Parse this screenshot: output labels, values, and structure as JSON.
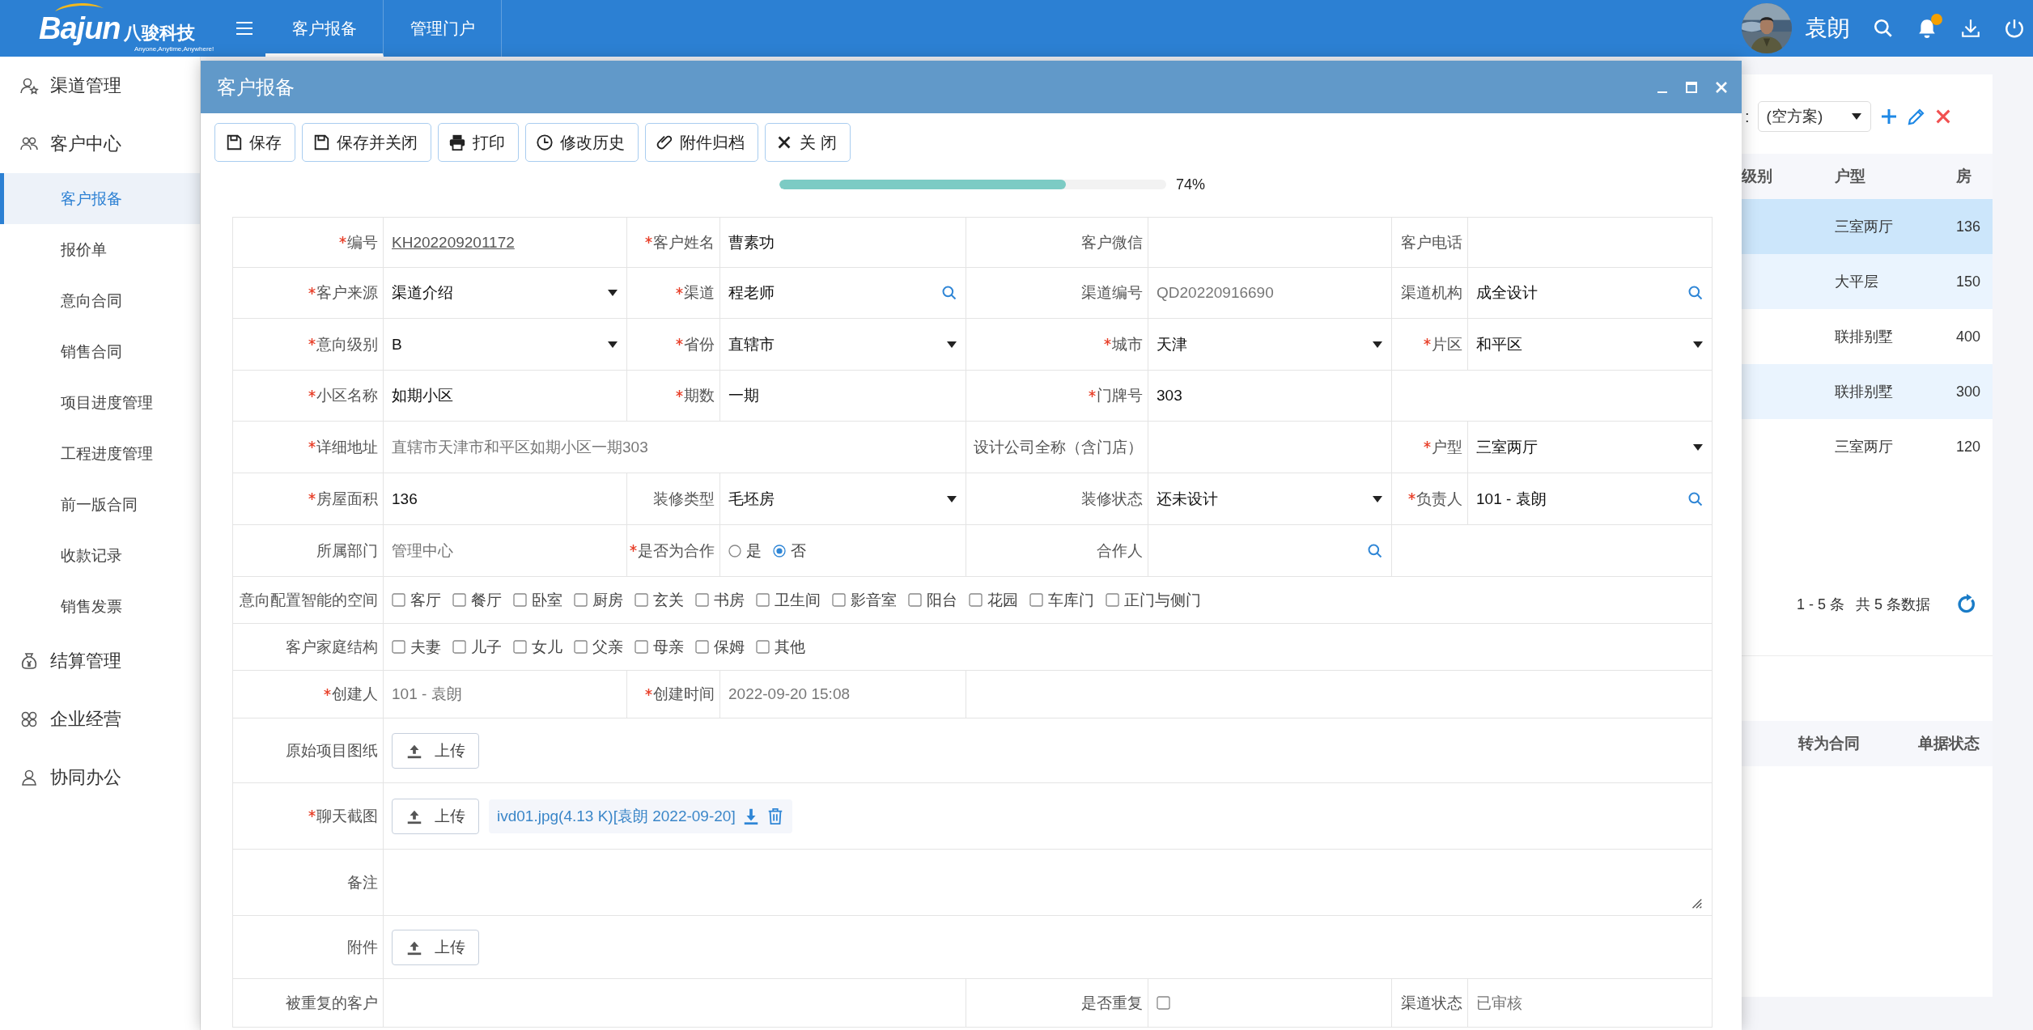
{
  "header": {
    "logo": {
      "brand": "Bajun",
      "name": "八骏科技",
      "tagline": "Anyone,Anytime,Anywhere!"
    },
    "tabs": [
      {
        "label": "客户报备",
        "selected": true
      },
      {
        "label": "管理门户",
        "selected": false
      }
    ],
    "user": {
      "name": "袁朗"
    },
    "notification_dot": true
  },
  "sidebar": {
    "items": [
      {
        "label": "渠道管理"
      },
      {
        "label": "客户中心",
        "children": [
          {
            "label": "客户报备",
            "selected": true
          },
          {
            "label": "报价单",
            "selected": false
          },
          {
            "label": "意向合同",
            "selected": false
          },
          {
            "label": "销售合同",
            "selected": false
          },
          {
            "label": "项目进度管理",
            "selected": false
          },
          {
            "label": "工程进度管理",
            "selected": false
          },
          {
            "label": "前一版合同",
            "selected": false
          },
          {
            "label": "收款记录",
            "selected": false
          },
          {
            "label": "销售发票",
            "selected": false
          }
        ]
      },
      {
        "label": "结算管理"
      },
      {
        "label": "企业经营"
      },
      {
        "label": "协同办公"
      }
    ]
  },
  "background": {
    "scheme": {
      "label": ":",
      "value": "(空方案)"
    },
    "table": {
      "columns": [
        "级别",
        "户型",
        "房"
      ],
      "rows": [
        {
          "cells": [
            "",
            "三室两厅",
            "136"
          ],
          "selected": true
        },
        {
          "cells": [
            "",
            "大平层",
            "150"
          ],
          "selected": false
        },
        {
          "cells": [
            "",
            "联排别墅",
            "400"
          ],
          "selected": false
        },
        {
          "cells": [
            "",
            "联排别墅",
            "300"
          ],
          "selected": false
        },
        {
          "cells": [
            "",
            "三室两厅",
            "120"
          ],
          "selected": false
        }
      ]
    },
    "pagination": {
      "range": "1 - 5 条",
      "total": "共 5 条数据"
    },
    "table_2": {
      "columns": [
        "转为合同",
        "单据状态"
      ]
    }
  },
  "dialog": {
    "title": "客户报备",
    "toolbar": [
      {
        "label": "保存"
      },
      {
        "label": "保存并关闭"
      },
      {
        "label": "打印"
      },
      {
        "label": "修改历史"
      },
      {
        "label": "附件归档"
      },
      {
        "label": "关 闭"
      }
    ],
    "progress": {
      "level": 0.74,
      "reading": "74%"
    }
  },
  "form": {
    "rows": [
      {
        "fields": [
          {
            "label": "编号",
            "required": true,
            "kind": "link",
            "value": "KH202209201172"
          },
          {
            "label": "客户姓名",
            "required": true,
            "kind": "input",
            "value": "曹素功"
          },
          {
            "label": "客户微信",
            "required": false,
            "kind": "input"
          },
          {
            "label": "客户电话",
            "required": false,
            "kind": "input"
          }
        ]
      },
      {
        "fields": [
          {
            "label": "客户来源",
            "required": true,
            "kind": "select",
            "value": "渠道介绍"
          },
          {
            "label": "渠道",
            "required": true,
            "kind": "lookup",
            "value": "程老师"
          },
          {
            "label": "渠道编号",
            "required": false,
            "kind": "text",
            "value": "QD20220916690"
          },
          {
            "label": "渠道机构",
            "required": false,
            "kind": "lookup",
            "value": "成全设计"
          }
        ]
      },
      {
        "fields": [
          {
            "label": "意向级别",
            "required": true,
            "kind": "select",
            "value": "B"
          },
          {
            "label": "省份",
            "required": true,
            "kind": "select",
            "value": "直辖市"
          },
          {
            "label": "城市",
            "required": true,
            "kind": "select",
            "value": "天津"
          },
          {
            "label": "片区",
            "required": true,
            "kind": "select",
            "value": "和平区"
          }
        ]
      },
      {
        "fields": [
          {
            "label": "小区名称",
            "required": true,
            "kind": "input",
            "value": "如期小区"
          },
          {
            "label": "期数",
            "required": true,
            "kind": "input",
            "value": "一期"
          },
          {
            "label": "门牌号",
            "required": true,
            "kind": "input",
            "value": "303"
          }
        ]
      },
      {
        "fields": [
          {
            "label": "详细地址",
            "required": true,
            "kind": "text",
            "value": "直辖市天津市和平区如期小区一期303"
          },
          {
            "label": "设计公司全称（含门店）",
            "required": false,
            "kind": "input"
          },
          {
            "label": "户型",
            "required": true,
            "kind": "select",
            "value": "三室两厅"
          }
        ]
      },
      {
        "fields": [
          {
            "label": "房屋面积",
            "required": true,
            "kind": "input",
            "value": "136"
          },
          {
            "label": "装修类型",
            "required": false,
            "kind": "select",
            "value": "毛坯房"
          },
          {
            "label": "装修状态",
            "required": false,
            "kind": "select",
            "value": "还未设计"
          },
          {
            "label": "负责人",
            "required": true,
            "kind": "lookup",
            "value": "101 - 袁朗"
          }
        ]
      },
      {
        "fields": [
          {
            "label": "所属部门",
            "required": false,
            "kind": "text",
            "value": "管理中心"
          },
          {
            "label": "是否为合作",
            "required": true,
            "kind": "radio",
            "options": [
              {
                "label": "是",
                "selected": false
              },
              {
                "label": "否",
                "selected": true
              }
            ]
          },
          {
            "label": "合作人",
            "required": false,
            "kind": "lookup"
          }
        ]
      },
      {
        "fields": [
          {
            "label": "意向配置智能的空间",
            "required": false,
            "kind": "checks",
            "options": [
              {
                "label": "客厅",
                "checked": false
              },
              {
                "label": "餐厅",
                "checked": false
              },
              {
                "label": "卧室",
                "checked": false
              },
              {
                "label": "厨房",
                "checked": false
              },
              {
                "label": "玄关",
                "checked": false
              },
              {
                "label": "书房",
                "checked": false
              },
              {
                "label": "卫生间",
                "checked": false
              },
              {
                "label": "影音室",
                "checked": false
              },
              {
                "label": "阳台",
                "checked": false
              },
              {
                "label": "花园",
                "checked": false
              },
              {
                "label": "车库门",
                "checked": false
              },
              {
                "label": "正门与侧门",
                "checked": false
              }
            ]
          }
        ]
      },
      {
        "fields": [
          {
            "label": "客户家庭结构",
            "required": false,
            "kind": "checks",
            "options": [
              {
                "label": "夫妻",
                "checked": false
              },
              {
                "label": "儿子",
                "checked": false
              },
              {
                "label": "女儿",
                "checked": false
              },
              {
                "label": "父亲",
                "checked": false
              },
              {
                "label": "母亲",
                "checked": false
              },
              {
                "label": "保姆",
                "checked": false
              },
              {
                "label": "其他",
                "checked": false
              }
            ]
          }
        ]
      },
      {
        "fields": [
          {
            "label": "创建人",
            "required": true,
            "kind": "text",
            "value": "101 - 袁朗"
          },
          {
            "label": "创建时间",
            "required": true,
            "kind": "text",
            "value": "2022-09-20 15:08"
          }
        ]
      },
      {
        "fields": [
          {
            "label": "原始项目图纸",
            "required": false,
            "kind": "upload",
            "button": "上传"
          }
        ]
      },
      {
        "fields": [
          {
            "label": "聊天截图",
            "required": true,
            "kind": "upload",
            "button": "上传",
            "files": [
              {
                "name": "ivd01.jpg(4.13 K)[袁朗 2022-09-20]"
              }
            ]
          }
        ]
      },
      {
        "fields": [
          {
            "label": "备注",
            "required": false,
            "kind": "textarea"
          }
        ]
      },
      {
        "fields": [
          {
            "label": "附件",
            "required": false,
            "kind": "upload",
            "button": "上传"
          }
        ]
      },
      {
        "fields": [
          {
            "label": "被重复的客户",
            "required": false,
            "kind": "input"
          },
          {
            "label": "是否重复",
            "required": false,
            "kind": "checkbox",
            "checked": false
          },
          {
            "label": "渠道状态",
            "required": false,
            "kind": "text",
            "value": "已审核"
          }
        ]
      }
    ]
  }
}
